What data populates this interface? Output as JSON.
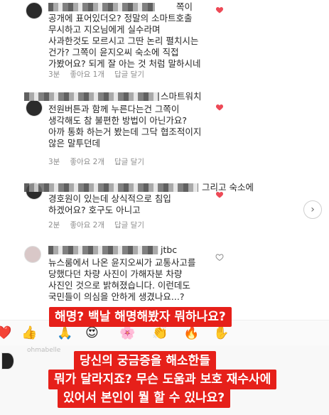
{
  "comments": [
    {
      "lines": [
        "쪽이",
        "공개에 표어있더오? 정말의 소마트호출",
        "무시하고 지오님에게 실수라며",
        "사과한것도 모르시고 그딴 논리 펼치시는",
        "건가? 그쪽이 윤지오씨 숙소에 직접",
        "가봤어요? 되게 잘 아는 것 처럼 말하시네"
      ],
      "time": "3분",
      "likes": "좋아요 1개",
      "reply": "답글 달기"
    },
    {
      "lines": [
        "스마트워치",
        "전원버튼과 함께 누른다는건 그쪽이",
        "생각해도 참 불편한 방법이 아닌가요?",
        "아까 통화 하는거 봤는데 그닥 협조적이지",
        "않은 말투던데"
      ],
      "time": "3분",
      "likes": "좋아요 2개",
      "reply": "답글 달기"
    },
    {
      "lines": [
        "그리고 숙소에",
        "경호원이 있는데 상식적으로 침입",
        "하겠어요? 호구도 아니고"
      ],
      "time": "2분",
      "likes": "좋아요 2개",
      "reply": "답글 달기"
    },
    {
      "lines": [
        "jtbc",
        "뉴스룸에서 나온 윤지오씨가 교통사고를",
        "당했다던 차량 사진이 가해자분 차량",
        "사진인 것으로 밝혀졌습니다. 이런데도",
        "국민들이 의심을 안하게 생겼나요...?"
      ]
    }
  ],
  "emoji_bar": [
    "❤️",
    "👍",
    "🙏",
    "😍",
    "🌸",
    "👏",
    "🔥",
    "✋"
  ],
  "captions": {
    "top": "해명? 백날 해명해봤자 뭐하나요?",
    "bottom_1": "당신의 궁금증을 해소한들",
    "bottom_2": "뭐가 달라지죠? 무슨 도움과 보호 재수사에",
    "bottom_3": "있어서 본인이 뭘 할 수 있나요?"
  },
  "handle": "ohmabelle",
  "colors": {
    "heart": "#ed4956",
    "caption_bg": "#e6201a",
    "meta": "#8e8e8e"
  }
}
